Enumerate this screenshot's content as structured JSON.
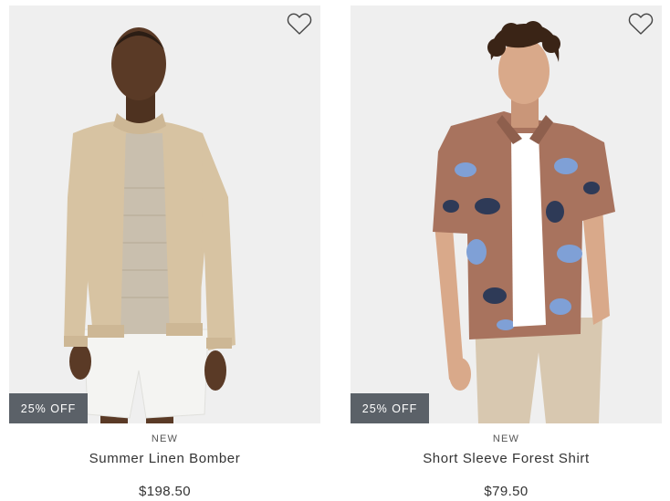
{
  "products": [
    {
      "tag": "NEW",
      "name": "Summer Linen Bomber",
      "price": "$198.50",
      "badge": "25% OFF",
      "wishlist_icon": "heart-outline-icon",
      "image_colors": {
        "background": "#efefef",
        "jacket": "#d7c3a2",
        "tee": "#c9bfae",
        "shorts": "#f4f4f2",
        "skin": "#5a3a26"
      }
    },
    {
      "tag": "NEW",
      "name": "Short Sleeve Forest Shirt",
      "price": "$79.50",
      "badge": "25% OFF",
      "wishlist_icon": "heart-outline-icon",
      "image_colors": {
        "background": "#efefef",
        "shirt": "#a8735e",
        "print": "#7fa0d6",
        "tee": "#ffffff",
        "pants": "#d8c8b0",
        "skin": "#d9a98a"
      }
    }
  ]
}
